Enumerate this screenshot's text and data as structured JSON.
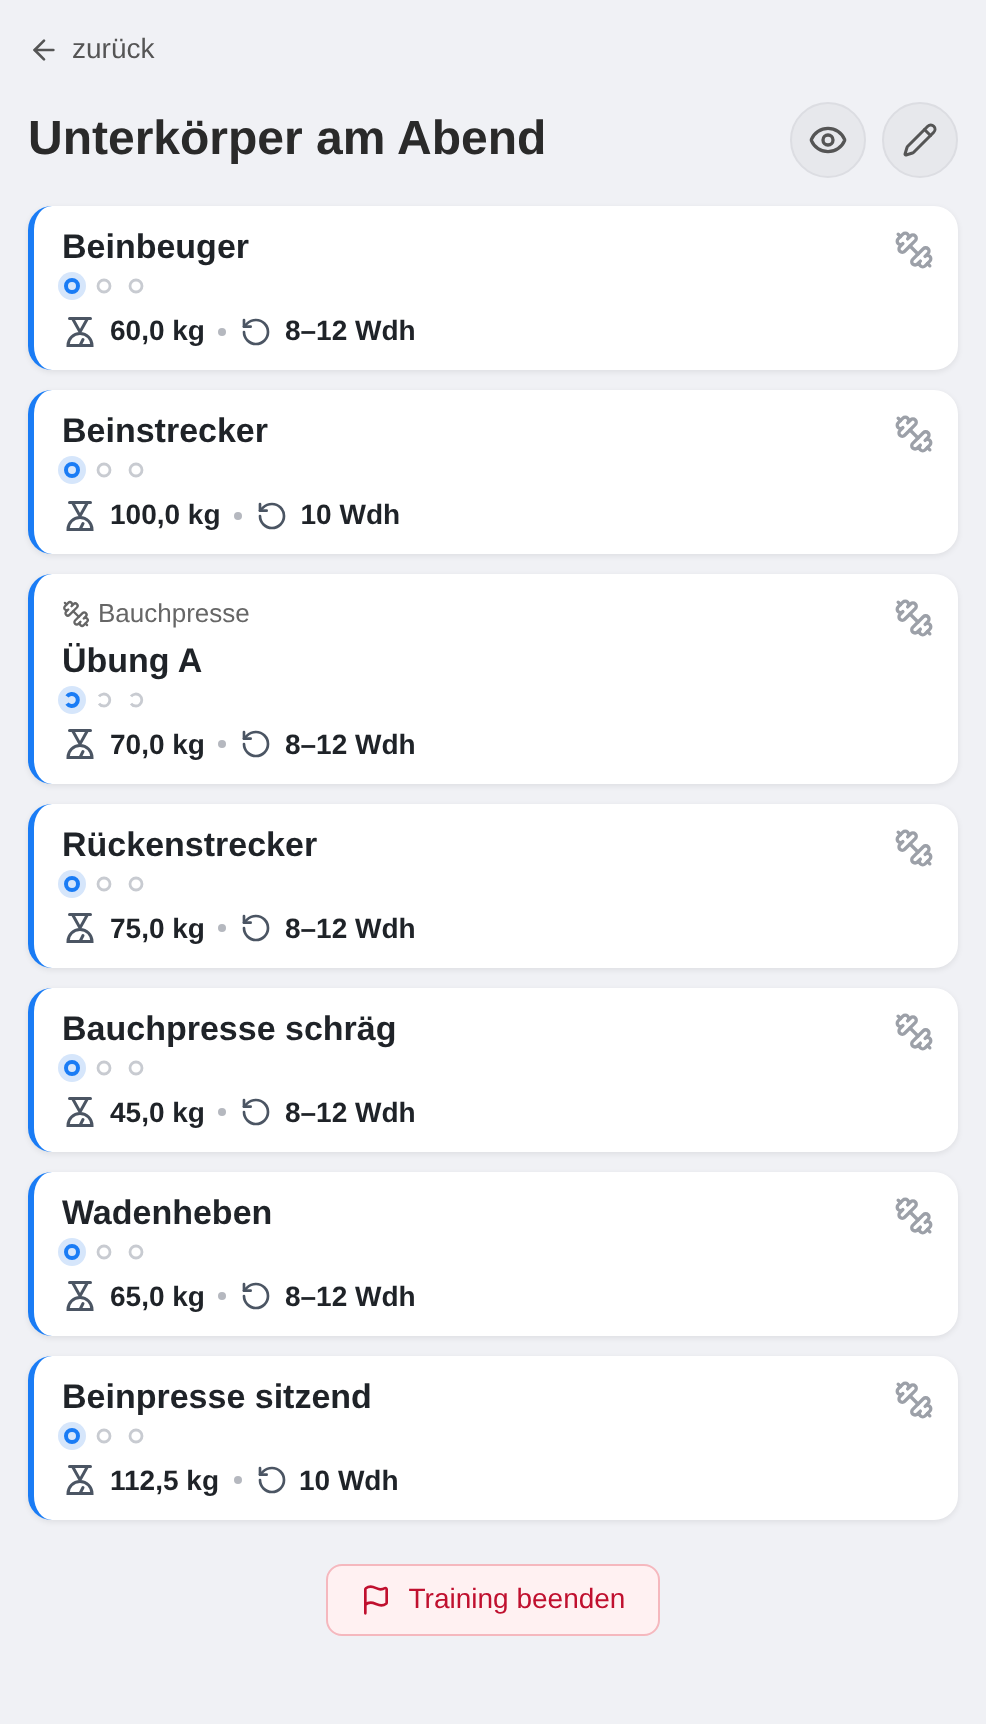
{
  "back_link": "zurück",
  "title": "Unterkörper am Abend",
  "exercises": [
    {
      "kind": "single",
      "name": "Beinbeuger",
      "sets": [
        {
          "selected": true
        },
        {
          "selected": false
        },
        {
          "selected": false
        }
      ],
      "weight": "60,0 kg",
      "reps": "8–12 Wdh"
    },
    {
      "kind": "single",
      "name": "Beinstrecker",
      "sets": [
        {
          "selected": true
        },
        {
          "selected": false
        },
        {
          "selected": false
        }
      ],
      "weight": "100,0 kg",
      "reps": "10 Wdh"
    },
    {
      "kind": "superset",
      "linked": "Bauchpresse",
      "name": "Übung A",
      "sets": [
        {
          "selected": true
        },
        {
          "selected": false
        },
        {
          "selected": false
        }
      ],
      "weight": "70,0 kg",
      "reps": "8–12 Wdh"
    },
    {
      "kind": "single",
      "name": "Rückenstrecker",
      "sets": [
        {
          "selected": true
        },
        {
          "selected": false
        },
        {
          "selected": false
        }
      ],
      "weight": "75,0 kg",
      "reps": "8–12 Wdh"
    },
    {
      "kind": "single",
      "name": "Bauchpresse schräg",
      "sets": [
        {
          "selected": true
        },
        {
          "selected": false
        },
        {
          "selected": false
        }
      ],
      "weight": "45,0 kg",
      "reps": "8–12 Wdh"
    },
    {
      "kind": "single",
      "name": "Wadenheben",
      "sets": [
        {
          "selected": true
        },
        {
          "selected": false
        },
        {
          "selected": false
        }
      ],
      "weight": "65,0 kg",
      "reps": "8–12 Wdh"
    },
    {
      "kind": "single",
      "name": "Beinpresse sitzend",
      "sets": [
        {
          "selected": true
        },
        {
          "selected": false
        },
        {
          "selected": false
        }
      ],
      "weight": "112,5 kg",
      "reps": "10 Wdh"
    }
  ],
  "finish_button": "Training beenden"
}
